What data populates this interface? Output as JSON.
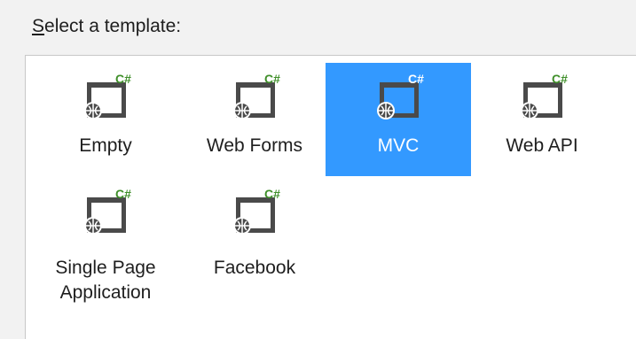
{
  "dialog": {
    "label_accel": "S",
    "label_rest": "elect a template:"
  },
  "templates": [
    {
      "id": "empty",
      "label": "Empty",
      "selected": false
    },
    {
      "id": "web-forms",
      "label": "Web Forms",
      "selected": false
    },
    {
      "id": "mvc",
      "label": "MVC",
      "selected": true
    },
    {
      "id": "web-api",
      "label": "Web API",
      "selected": false
    },
    {
      "id": "single-page-application",
      "label": "Single Page\nApplication",
      "selected": false
    },
    {
      "id": "facebook",
      "label": "Facebook",
      "selected": false
    }
  ],
  "icon": {
    "name": "web-project-csharp-icon",
    "badge_text": "C#",
    "badge_color": "#3f8f2a",
    "selected_badge_color": "#ffffff",
    "body_color": "#4a4a4a",
    "globe_color": "#ffffff"
  }
}
